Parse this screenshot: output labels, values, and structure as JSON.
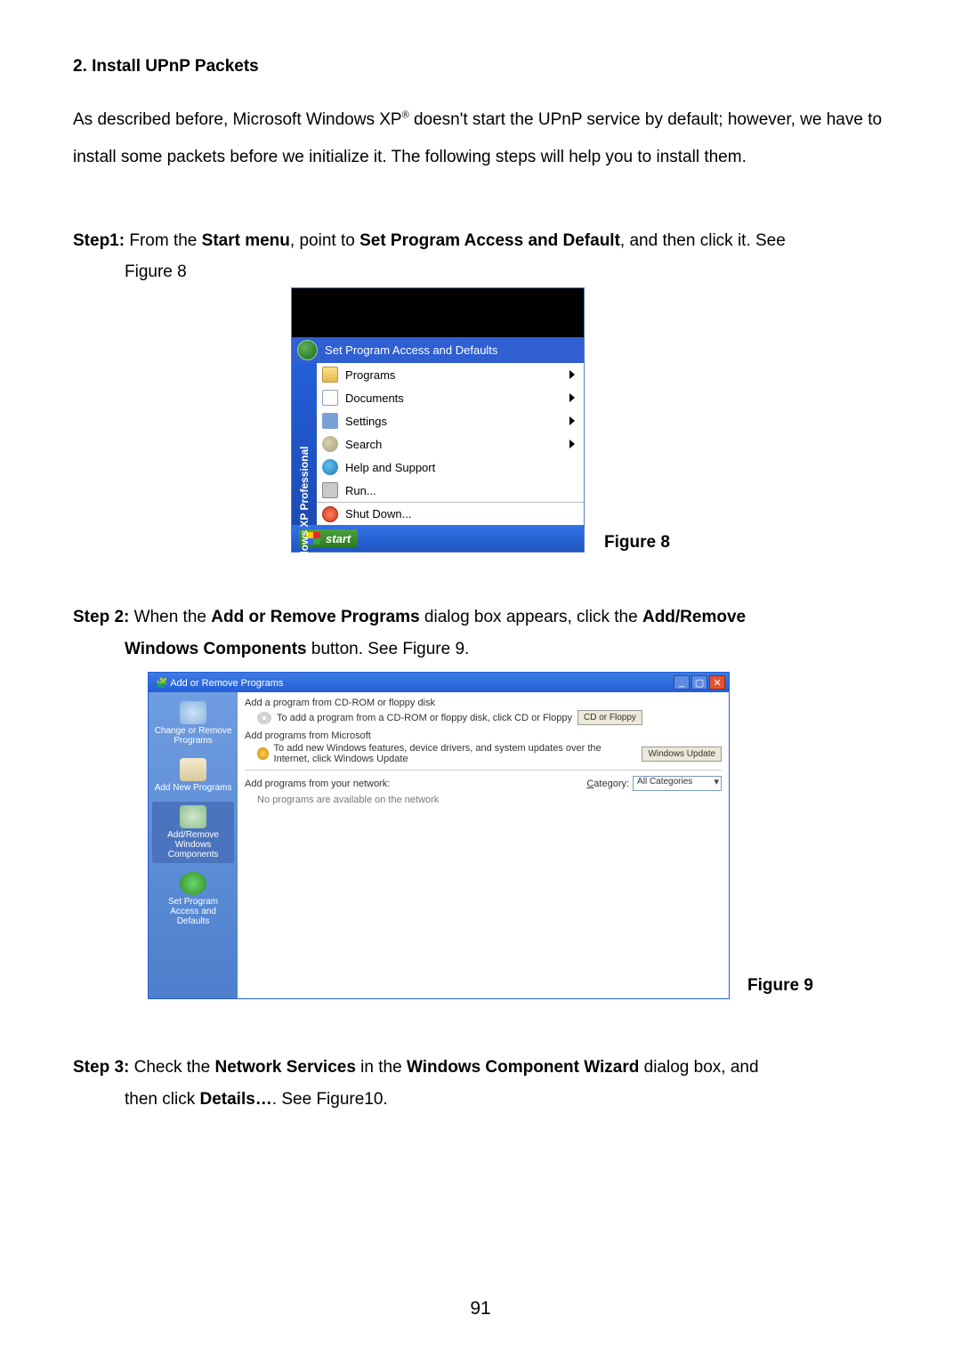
{
  "heading": "2. Install UPnP Packets",
  "para_part1": "As described before, Microsoft Windows XP",
  "para_sup": "®",
  "para_part2": " doesn't start the UPnP service by default; however, we have to install some packets before we initialize it. The following steps will help you to install them.",
  "step1_label": "Step1:",
  "step1_text_1": " From the ",
  "step1_b1": "Start menu",
  "step1_text_2": ", point to ",
  "step1_b2": "Set Program Access and Default",
  "step1_text_3": ", and then click it. See",
  "step1_figref": "Figure 8",
  "figure8_label": "Figure 8",
  "startmenu": {
    "highlighted": "Set Program Access and Defaults",
    "side_label": "Windows XP Professional",
    "items": {
      "programs": "Programs",
      "documents": "Documents",
      "settings": "Settings",
      "search": "Search",
      "help": "Help and Support",
      "run": "Run...",
      "shutdown": "Shut Down..."
    },
    "start_btn": "start"
  },
  "step2_label": "Step 2:",
  "step2_text_1": " When the ",
  "step2_b1": "Add or Remove Programs",
  "step2_text_2": " dialog box appears, click the ",
  "step2_b2": "Add/Remove",
  "step2_cont_b": "Windows Components",
  "step2_cont_text": " button. See Figure 9.",
  "figure9_label": "Figure 9",
  "arp": {
    "title": "Add or Remove Programs",
    "sidebar": {
      "change": "Change or Remove Programs",
      "addnew": "Add New Programs",
      "addwin": "Add/Remove Windows Components",
      "defaults": "Set Program Access and Defaults"
    },
    "group1_title": "Add a program from CD-ROM or floppy disk",
    "group1_desc": "To add a program from a CD-ROM or floppy disk, click CD or Floppy",
    "group1_btn": "CD or Floppy",
    "group2_title": "Add programs from Microsoft",
    "group2_desc": "To add new Windows features, device drivers, and system updates over the Internet, click Windows Update",
    "group2_btn": "Windows Update",
    "group3_title": "Add programs from your network:",
    "category_label": "Category:",
    "category_value": "All Categories",
    "empty_msg": "No programs are available on the network"
  },
  "step3_label": "Step 3:",
  "step3_text_1": " Check the ",
  "step3_b1": "Network Services",
  "step3_text_2": " in the ",
  "step3_b2": "Windows Component Wizard",
  "step3_text_3": " dialog box, and",
  "step3_cont_1": "then click ",
  "step3_cont_b": "Details…",
  "step3_cont_2": ". See Figure10.",
  "page_number": "91"
}
